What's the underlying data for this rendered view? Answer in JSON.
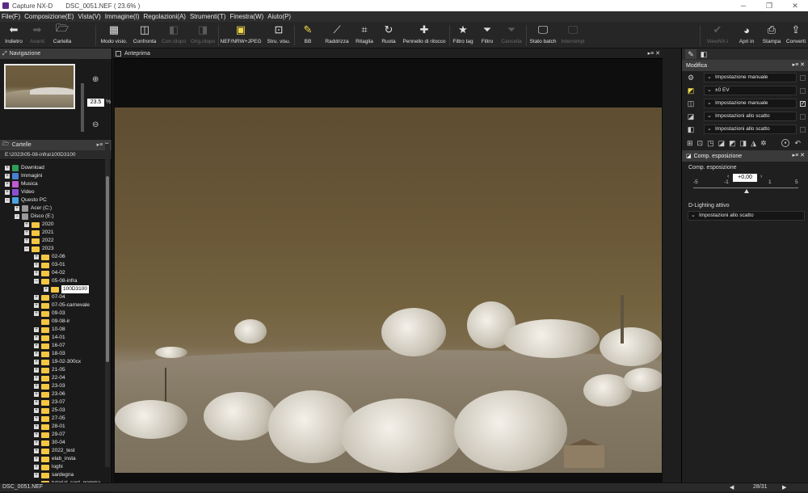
{
  "window": {
    "app_name": "Capture NX-D",
    "doc_title": "DSC_0051.NEF ( 23.6% )",
    "controls": [
      "─",
      "❐",
      "✕"
    ]
  },
  "menu": [
    "File(F)",
    "Composizione(E)",
    "Vista(V)",
    "Immagine(I)",
    "Regolazioni(A)",
    "Strumenti(T)",
    "Finestra(W)",
    "Aiuto(P)"
  ],
  "toolbar": {
    "back": "Indietro",
    "forward": "Avanti",
    "folder": "Cartella",
    "view_mode": "Modo visio.",
    "compare": "Confronta",
    "before_after": "Corr./dopo",
    "orig_after": "Orig./dopo",
    "nef_jpeg": "NEF/NRW+JPEG",
    "view_tools": "Stru. visu.",
    "wb": "BB",
    "straighten": "Raddrizza",
    "crop": "Ritaglia",
    "rotate": "Ruota",
    "retouch": "Pennello di ritocco",
    "filter_tag": "Filtro tag",
    "filter": "Filtro",
    "delete": "Cancella",
    "batch_status": "Stato batch",
    "interrupt": "Interrompi",
    "viewnx": "ViewNX-i",
    "open_in": "Apri in",
    "print": "Stampa",
    "convert": "Converti"
  },
  "navigation": {
    "title": "Navigazione",
    "zoom_value": "23.5",
    "zoom_unit": "%"
  },
  "folders": {
    "title": "Cartelle",
    "path": "E:\\2023\\05-08-infra\\100D3100",
    "items": [
      {
        "label": "Download",
        "level": 0,
        "exp": "+",
        "kind": "download"
      },
      {
        "label": "Immagini",
        "level": 0,
        "exp": "+",
        "kind": "images"
      },
      {
        "label": "Musica",
        "level": 0,
        "exp": "+",
        "kind": "music"
      },
      {
        "label": "Video",
        "level": 0,
        "exp": "+",
        "kind": "video"
      },
      {
        "label": "Questo PC",
        "level": 0,
        "exp": "−",
        "kind": "pc"
      },
      {
        "label": "Acer (C:)",
        "level": 1,
        "exp": "+",
        "kind": "drive"
      },
      {
        "label": "Disco (E:)",
        "level": 1,
        "exp": "−",
        "kind": "drive"
      },
      {
        "label": "2020",
        "level": 2,
        "exp": "+",
        "kind": "folder"
      },
      {
        "label": "2021",
        "level": 2,
        "exp": "+",
        "kind": "folder"
      },
      {
        "label": "2022",
        "level": 2,
        "exp": "+",
        "kind": "folder"
      },
      {
        "label": "2023",
        "level": 2,
        "exp": "−",
        "kind": "folder"
      },
      {
        "label": "02-06",
        "level": 3,
        "exp": "+",
        "kind": "folder"
      },
      {
        "label": "03-01",
        "level": 3,
        "exp": "+",
        "kind": "folder"
      },
      {
        "label": "04-02",
        "level": 3,
        "exp": "+",
        "kind": "folder"
      },
      {
        "label": "05-08-infra",
        "level": 3,
        "exp": "−",
        "kind": "folder"
      },
      {
        "label": "100D3100",
        "level": 4,
        "exp": "+",
        "kind": "folder",
        "selected": true
      },
      {
        "label": "07-04",
        "level": 3,
        "exp": "+",
        "kind": "folder"
      },
      {
        "label": "07-05-carnevale",
        "level": 3,
        "exp": "+",
        "kind": "folder"
      },
      {
        "label": "09-03",
        "level": 3,
        "exp": "+",
        "kind": "folder"
      },
      {
        "label": "09-08-ir",
        "level": 3,
        "exp": "",
        "kind": "folder"
      },
      {
        "label": "10-08",
        "level": 3,
        "exp": "+",
        "kind": "folder"
      },
      {
        "label": "14-01",
        "level": 3,
        "exp": "+",
        "kind": "folder"
      },
      {
        "label": "16-07",
        "level": 3,
        "exp": "+",
        "kind": "folder"
      },
      {
        "label": "18-03",
        "level": 3,
        "exp": "+",
        "kind": "folder"
      },
      {
        "label": "19-02-300cx",
        "level": 3,
        "exp": "+",
        "kind": "folder"
      },
      {
        "label": "21-05",
        "level": 3,
        "exp": "+",
        "kind": "folder"
      },
      {
        "label": "22-04",
        "level": 3,
        "exp": "+",
        "kind": "folder"
      },
      {
        "label": "23-03",
        "level": 3,
        "exp": "+",
        "kind": "folder"
      },
      {
        "label": "23-06",
        "level": 3,
        "exp": "+",
        "kind": "folder"
      },
      {
        "label": "23-07",
        "level": 3,
        "exp": "+",
        "kind": "folder"
      },
      {
        "label": "25-03",
        "level": 3,
        "exp": "+",
        "kind": "folder"
      },
      {
        "label": "27-05",
        "level": 3,
        "exp": "+",
        "kind": "folder"
      },
      {
        "label": "28-01",
        "level": 3,
        "exp": "+",
        "kind": "folder"
      },
      {
        "label": "29-07",
        "level": 3,
        "exp": "+",
        "kind": "folder"
      },
      {
        "label": "30-04",
        "level": 3,
        "exp": "+",
        "kind": "folder"
      },
      {
        "label": "2022_test",
        "level": 3,
        "exp": "+",
        "kind": "folder"
      },
      {
        "label": "elab_insta",
        "level": 3,
        "exp": "+",
        "kind": "folder"
      },
      {
        "label": "loghi",
        "level": 3,
        "exp": "+",
        "kind": "folder"
      },
      {
        "label": "sardegna",
        "level": 3,
        "exp": "+",
        "kind": "folder"
      },
      {
        "label": "tutorial_sost_gomma",
        "level": 3,
        "exp": "",
        "kind": "folder"
      }
    ]
  },
  "preview": {
    "title": "Anteprima"
  },
  "modifica": {
    "title": "Modifica",
    "rows": [
      {
        "icon": "gear-icon",
        "value": "Impostazione manuale",
        "checked": false
      },
      {
        "icon": "exposure-icon",
        "value": "±0 EV",
        "checked": false
      },
      {
        "icon": "wb-icon",
        "value": "Impostazione manuale",
        "checked": true
      },
      {
        "icon": "picture-control-icon",
        "value": "Impostazioni allo scatto",
        "checked": false
      },
      {
        "icon": "lens-icon",
        "value": "Impostazioni allo scatto",
        "checked": false
      }
    ]
  },
  "exposure": {
    "panel_title": "Comp. esposizione",
    "label": "Comp. esposizione",
    "value": "+0,00",
    "scale": [
      "-5",
      "-1",
      "0",
      "1",
      "5"
    ],
    "dlighting_label": "D-Lighting attivo",
    "dlighting_value": "Impostazioni allo scatto"
  },
  "status": {
    "file": "DSC_0051.NEF",
    "page": "28/31"
  }
}
